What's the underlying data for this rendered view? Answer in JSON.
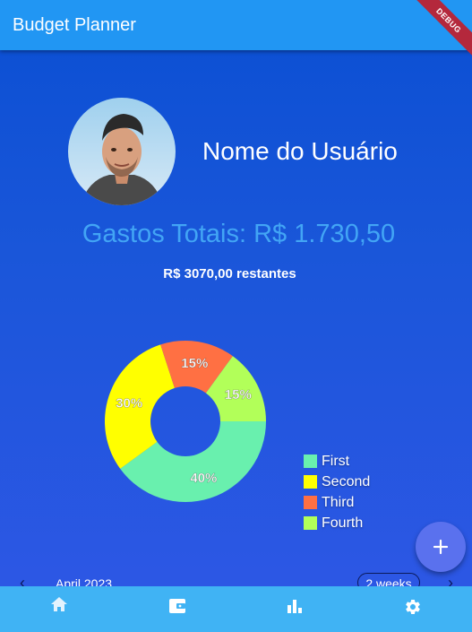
{
  "app": {
    "title": "Budget Planner",
    "debug_label": "DEBUG"
  },
  "profile": {
    "user_name": "Nome do Usuário"
  },
  "summary": {
    "total_spent": "Gastos Totais: R$ 1.730,50",
    "remaining": "R$ 3070,00 restantes"
  },
  "chart_data": {
    "type": "pie",
    "donut": true,
    "slices": [
      {
        "label": "First",
        "value": 40,
        "percent_label": "40%",
        "color": "#69f0ae"
      },
      {
        "label": "Second",
        "value": 30,
        "percent_label": "30%",
        "color": "#ffff00"
      },
      {
        "label": "Third",
        "value": 15,
        "percent_label": "15%",
        "color": "#ff7043"
      },
      {
        "label": "Fourth",
        "value": 15,
        "percent_label": "15%",
        "color": "#b2ff59"
      }
    ],
    "legend_position": "bottom-right"
  },
  "calendar": {
    "month": "April 2023",
    "format_button": "2 weeks"
  },
  "fab": {
    "icon": "add-icon"
  },
  "bottom_nav": {
    "items": [
      {
        "icon": "home-icon"
      },
      {
        "icon": "wallet-icon"
      },
      {
        "icon": "bar-chart-icon"
      },
      {
        "icon": "settings-icon"
      }
    ],
    "active_color": "#e3f2fd"
  },
  "colors": {
    "appbar": "#2196f3",
    "accent_total": "#42a5f5",
    "bottom_nav": "#40b3f4"
  }
}
